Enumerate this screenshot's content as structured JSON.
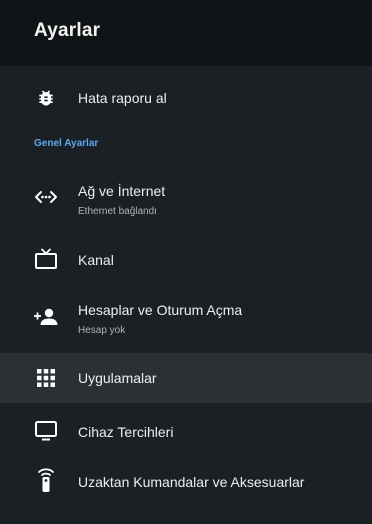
{
  "header": {
    "title": "Ayarlar"
  },
  "items_top": [
    {
      "label": "Hata raporu al",
      "icon": "bug-icon"
    }
  ],
  "section": {
    "title": "Genel Ayarlar"
  },
  "items": [
    {
      "label": "Ağ ve İnternet",
      "sublabel": "Ethernet bağlandı",
      "icon": "network-icon"
    },
    {
      "label": "Kanal",
      "icon": "tv-icon"
    },
    {
      "label": "Hesaplar ve Oturum Açma",
      "sublabel": "Hesap yok",
      "icon": "add-account-icon"
    },
    {
      "label": "Uygulamalar",
      "icon": "apps-grid-icon",
      "selected": true
    },
    {
      "label": "Cihaz Tercihleri",
      "icon": "monitor-icon"
    },
    {
      "label": "Uzaktan Kumandalar ve Aksesuarlar",
      "icon": "remote-icon"
    }
  ],
  "colors": {
    "background": "#1b2024",
    "header_background": "#111417",
    "selected_row": "#2b3033",
    "section_accent": "#5aa9f2"
  }
}
